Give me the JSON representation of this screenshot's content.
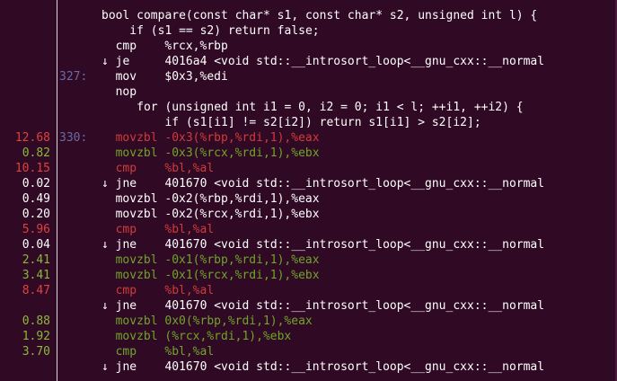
{
  "colors": {
    "background": "#300a24",
    "hot": "#d23a3a",
    "warm": "#6fa52a",
    "normal": "#ffffff",
    "line_number": "#6a6aa6"
  },
  "rows": [
    {
      "pct": "",
      "lno": "",
      "text": "bool compare(const char* s1, const char* s2, unsigned int l) {",
      "color": "white",
      "indent": 0
    },
    {
      "pct": "",
      "lno": "",
      "text": "    if (s1 == s2) return false;",
      "color": "white",
      "indent": 0
    },
    {
      "pct": "",
      "lno": "",
      "text": "cmp    %rcx,%rbp",
      "color": "white",
      "indent": 2
    },
    {
      "pct": "",
      "lno": "",
      "text": "↓ je     4016a4 <void std::__introsort_loop<__gnu_cxx::__normal",
      "color": "white",
      "indent": 0
    },
    {
      "pct": "",
      "lno": "327:",
      "text": "mov    $0x3,%edi",
      "color": "white",
      "indent": 2
    },
    {
      "pct": "",
      "lno": "",
      "text": "nop",
      "color": "white",
      "indent": 2
    },
    {
      "pct": "",
      "lno": "",
      "text": "     for (unsigned int i1 = 0, i2 = 0; i1 < l; ++i1, ++i2) {",
      "color": "white",
      "indent": 0
    },
    {
      "pct": "",
      "lno": "",
      "text": "         if (s1[i1] != s2[i2]) return s1[i1] > s2[i2];",
      "color": "white",
      "indent": 0
    },
    {
      "pct": "12.68",
      "lno": "330:",
      "text": "movzbl -0x3(%rbp,%rdi,1),%eax",
      "color": "red",
      "indent": 2
    },
    {
      "pct": "0.82",
      "lno": "",
      "text": "movzbl -0x3(%rcx,%rdi,1),%ebx",
      "color": "green",
      "indent": 2
    },
    {
      "pct": "10.15",
      "lno": "",
      "text": "cmp    %bl,%al",
      "color": "red",
      "indent": 2
    },
    {
      "pct": "0.02",
      "lno": "",
      "text": "↓ jne    401670 <void std::__introsort_loop<__gnu_cxx::__normal",
      "color": "white",
      "indent": 0
    },
    {
      "pct": "0.49",
      "lno": "",
      "text": "movzbl -0x2(%rbp,%rdi,1),%eax",
      "color": "white",
      "indent": 2
    },
    {
      "pct": "0.20",
      "lno": "",
      "text": "movzbl -0x2(%rcx,%rdi,1),%ebx",
      "color": "white",
      "indent": 2
    },
    {
      "pct": "5.96",
      "lno": "",
      "text": "cmp    %bl,%al",
      "color": "red",
      "indent": 2
    },
    {
      "pct": "0.04",
      "lno": "",
      "text": "↓ jne    401670 <void std::__introsort_loop<__gnu_cxx::__normal",
      "color": "white",
      "indent": 0
    },
    {
      "pct": "2.41",
      "lno": "",
      "text": "movzbl -0x1(%rbp,%rdi,1),%eax",
      "color": "green",
      "indent": 2
    },
    {
      "pct": "3.41",
      "lno": "",
      "text": "movzbl -0x1(%rcx,%rdi,1),%ebx",
      "color": "green",
      "indent": 2
    },
    {
      "pct": "8.47",
      "lno": "",
      "text": "cmp    %bl,%al",
      "color": "red",
      "indent": 2
    },
    {
      "pct": "",
      "lno": "",
      "text": "↓ jne    401670 <void std::__introsort_loop<__gnu_cxx::__normal",
      "color": "white",
      "indent": 0
    },
    {
      "pct": "0.88",
      "lno": "",
      "text": "movzbl 0x0(%rbp,%rdi,1),%eax",
      "color": "green",
      "indent": 2
    },
    {
      "pct": "1.92",
      "lno": "",
      "text": "movzbl (%rcx,%rdi,1),%ebx",
      "color": "green",
      "indent": 2
    },
    {
      "pct": "3.70",
      "lno": "",
      "text": "cmp    %bl,%al",
      "color": "green",
      "indent": 2
    },
    {
      "pct": "",
      "lno": "",
      "text": "↓ jne    401670 <void std::__introsort_loop<__gnu_cxx::__normal",
      "color": "white",
      "indent": 0
    }
  ]
}
